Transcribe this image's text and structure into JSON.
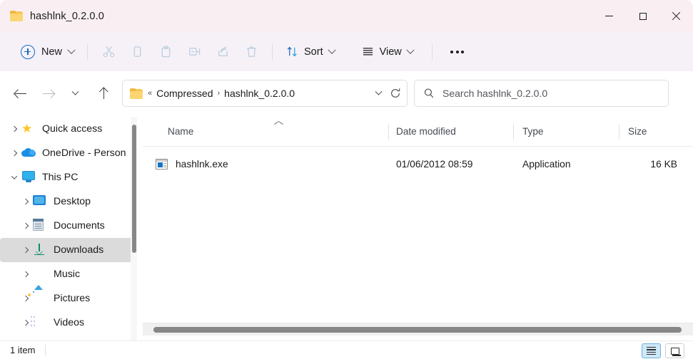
{
  "window": {
    "title": "hashlnk_0.2.0.0",
    "folder_icon": "folder-icon",
    "controls": {
      "minimize": "minimize-icon",
      "maximize": "maximize-icon",
      "close": "close-icon"
    }
  },
  "toolbar": {
    "new_label": "New",
    "new_icon": "plus-circle-icon",
    "actions": [
      {
        "name": "cut",
        "icon": "scissors-icon",
        "enabled": false
      },
      {
        "name": "copy",
        "icon": "copy-icon",
        "enabled": false
      },
      {
        "name": "paste",
        "icon": "clipboard-icon",
        "enabled": false
      },
      {
        "name": "rename",
        "icon": "rename-icon",
        "enabled": false
      },
      {
        "name": "share",
        "icon": "share-icon",
        "enabled": false
      },
      {
        "name": "delete",
        "icon": "trash-icon",
        "enabled": false
      }
    ],
    "sort_label": "Sort",
    "sort_icon": "sort-arrows-icon",
    "view_label": "View",
    "view_icon": "hamburger-icon",
    "overflow_icon": "ellipsis-icon"
  },
  "navigation": {
    "back_icon": "arrow-left-icon",
    "forward_icon": "arrow-right-icon",
    "recent_icon": "chevron-down-icon",
    "up_icon": "arrow-up-icon",
    "breadcrumb": {
      "folder_icon": "folder-icon",
      "prefix": "«",
      "items": [
        "Compressed",
        "hashlnk_0.2.0.0"
      ],
      "separator": "›",
      "dropdown_icon": "chevron-down-icon",
      "refresh_icon": "refresh-icon"
    }
  },
  "search": {
    "icon": "search-icon",
    "placeholder": "Search hashlnk_0.2.0.0",
    "value": ""
  },
  "sidebar": {
    "items": [
      {
        "label": "Quick access",
        "icon": "star-icon",
        "expanded": false,
        "indent": 0,
        "selected": false
      },
      {
        "label": "OneDrive - Person",
        "icon": "cloud-icon",
        "expanded": false,
        "indent": 0,
        "selected": false
      },
      {
        "label": "This PC",
        "icon": "pc-icon",
        "expanded": true,
        "indent": 0,
        "selected": false
      },
      {
        "label": "Desktop",
        "icon": "desktop-icon",
        "expanded": false,
        "indent": 1,
        "selected": false
      },
      {
        "label": "Documents",
        "icon": "documents-icon",
        "expanded": false,
        "indent": 1,
        "selected": false
      },
      {
        "label": "Downloads",
        "icon": "downloads-icon",
        "expanded": false,
        "indent": 1,
        "selected": true
      },
      {
        "label": "Music",
        "icon": "music-icon",
        "expanded": false,
        "indent": 1,
        "selected": false
      },
      {
        "label": "Pictures",
        "icon": "pictures-icon",
        "expanded": false,
        "indent": 1,
        "selected": false
      },
      {
        "label": "Videos",
        "icon": "videos-icon",
        "expanded": false,
        "indent": 1,
        "selected": false
      }
    ]
  },
  "file_list": {
    "columns": [
      {
        "label": "Name",
        "sorted": "ascending"
      },
      {
        "label": "Date modified",
        "sorted": ""
      },
      {
        "label": "Type",
        "sorted": ""
      },
      {
        "label": "Size",
        "sorted": ""
      }
    ],
    "rows": [
      {
        "name": "hashlnk.exe",
        "icon": "executable-icon",
        "date_modified": "01/06/2012 08:59",
        "type": "Application",
        "size": "16 KB"
      }
    ]
  },
  "status": {
    "item_count": "1 item",
    "details_view_icon": "details-view-icon",
    "large_icons_view_icon": "large-icons-view-icon",
    "active_view": "details"
  },
  "colors": {
    "titlebar": "#f9eff3",
    "commandbar": "#f6f1f7",
    "accent": "#1769c4",
    "selection": "#dbdbdb",
    "view_active": "#cfe8f7",
    "folder": "#f5c453"
  }
}
